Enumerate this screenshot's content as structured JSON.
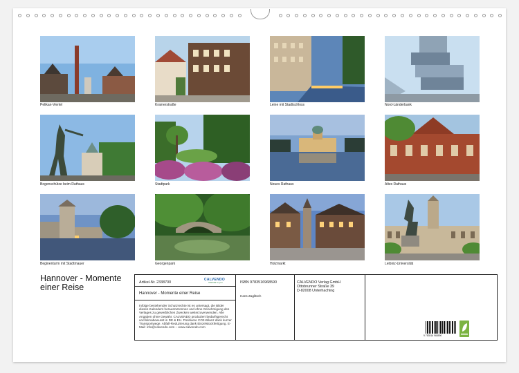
{
  "calendar": {
    "title": "Hannover - Momente einer Reise"
  },
  "photos": [
    {
      "caption": "Pelikan-Viertel"
    },
    {
      "caption": "Kramerstraße"
    },
    {
      "caption": "Leine mit Stadtschloss"
    },
    {
      "caption": "Nord-Länderbank"
    },
    {
      "caption": "Bogenschütze beim Rathaus"
    },
    {
      "caption": "Stadtpark"
    },
    {
      "caption": "Neues Rathaus"
    },
    {
      "caption": "Altes Rathaus"
    },
    {
      "caption": "Beginenturm mit Stadtmauer"
    },
    {
      "caption": "Georgenpark"
    },
    {
      "caption": "Holzmarkt"
    },
    {
      "caption": "Leibniz-Universität"
    }
  ],
  "info": {
    "article_no": "Artikel-Nr. 2338700",
    "publisher_logo": "CALVENDO",
    "publisher_logo_sub": "calendar to you",
    "calendar_name": "Hannover - Momente einer Reise",
    "legal_text": "Infolge bestehender Schutzrechte ist es untersagt, die Bilder dieses Kalenders herauszutrennen und ohne Genehmigung des Verlages zu gewerblichen Zwecken weiterzuverwenden. Alle Angaben ohne Gewähr. CALVENDO produziert bedarfsgerecht und klimabewusst in DE & EU. Positivere CO2-Bilanz dank kurzer Transportwege. Abfall-Reduzierung dank Einzelstückfertigung. E-Mail: info@calvendo.com – www.calvendo.com",
    "isbn": "ISBN 9783516968590",
    "author": "Hans Zaglitsch",
    "publisher_name": "CALVENDO Verlag GmbH",
    "publisher_street": "Ottobrunner Straße 39",
    "publisher_city": "D-82008 Unterhaching",
    "barcode_digits": "9 783516 968590"
  }
}
